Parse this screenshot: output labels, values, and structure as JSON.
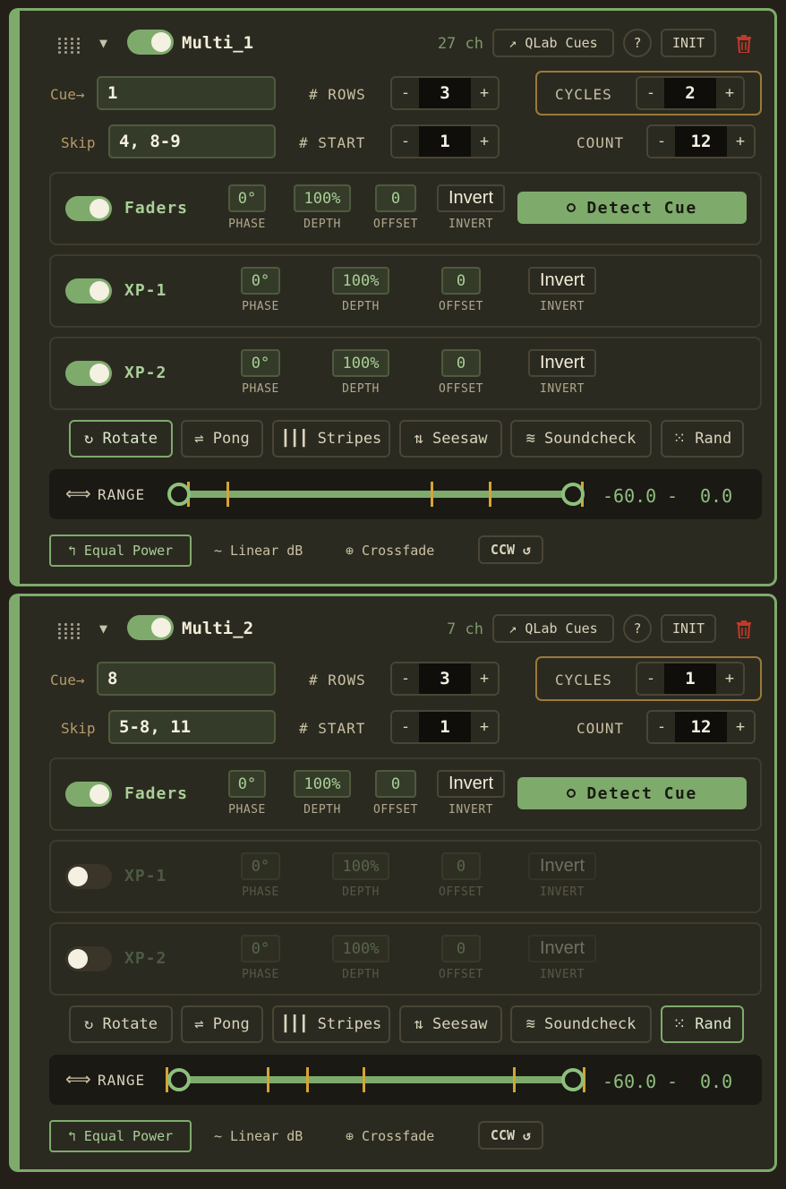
{
  "panels": [
    {
      "title": "Multi_1",
      "enabled": true,
      "channels": "27 ch",
      "qlab_label": "↗ QLab Cues",
      "help_label": "?",
      "init_label": "INIT",
      "cue_label": "Cue→",
      "cue_value": "1",
      "skip_label": "Skip",
      "skip_value": "4, 8-9",
      "rows_label": "# ROWS",
      "rows_value": "3",
      "start_label": "# START",
      "start_value": "1",
      "cycles_label": "CYCLES",
      "cycles_value": "2",
      "count_label": "COUNT",
      "count_value": "12",
      "minus": "-",
      "plus": "+",
      "detect_label": "Detect Cue",
      "tracks": [
        {
          "name": "Faders",
          "enabled": true,
          "phase": "0°",
          "depth": "100%",
          "offset": "0",
          "invert": "Invert"
        },
        {
          "name": "XP-1",
          "enabled": true,
          "phase": "0°",
          "depth": "100%",
          "offset": "0",
          "invert": "Invert"
        },
        {
          "name": "XP-2",
          "enabled": true,
          "phase": "0°",
          "depth": "100%",
          "offset": "0",
          "invert": "Invert"
        }
      ],
      "param_labels": {
        "phase": "PHASE",
        "depth": "DEPTH",
        "offset": "OFFSET",
        "invert": "INVERT"
      },
      "modes": [
        "↻ Rotate",
        "⇌ Pong",
        "┃┃┃ Stripes",
        "⇅ Seesaw",
        "≋ Soundcheck",
        "⁙ Rand"
      ],
      "selected_mode": "↻ Rotate",
      "range_label": "RANGE",
      "range_min": "-60.0",
      "range_sep": "-",
      "range_max": "0.0",
      "curves": [
        "↰ Equal Power",
        "~ Linear dB",
        "⊕ Crossfade"
      ],
      "selected_curve": "↰ Equal Power",
      "direction": "CCW ↺"
    },
    {
      "title": "Multi_2",
      "enabled": true,
      "channels": "7 ch",
      "qlab_label": "↗ QLab Cues",
      "help_label": "?",
      "init_label": "INIT",
      "cue_label": "Cue→",
      "cue_value": "8",
      "skip_label": "Skip",
      "skip_value": "5-8, 11",
      "rows_label": "# ROWS",
      "rows_value": "3",
      "start_label": "# START",
      "start_value": "1",
      "cycles_label": "CYCLES",
      "cycles_value": "1",
      "count_label": "COUNT",
      "count_value": "12",
      "minus": "-",
      "plus": "+",
      "detect_label": "Detect Cue",
      "tracks": [
        {
          "name": "Faders",
          "enabled": true,
          "phase": "0°",
          "depth": "100%",
          "offset": "0",
          "invert": "Invert"
        },
        {
          "name": "XP-1",
          "enabled": false,
          "phase": "0°",
          "depth": "100%",
          "offset": "0",
          "invert": "Invert"
        },
        {
          "name": "XP-2",
          "enabled": false,
          "phase": "0°",
          "depth": "100%",
          "offset": "0",
          "invert": "Invert"
        }
      ],
      "param_labels": {
        "phase": "PHASE",
        "depth": "DEPTH",
        "offset": "OFFSET",
        "invert": "INVERT"
      },
      "modes": [
        "↻ Rotate",
        "⇌ Pong",
        "┃┃┃ Stripes",
        "⇅ Seesaw",
        "≋ Soundcheck",
        "⁙ Rand"
      ],
      "selected_mode": "⁙ Rand",
      "range_label": "RANGE",
      "range_min": "-60.0",
      "range_sep": "-",
      "range_max": "0.0",
      "curves": [
        "↰ Equal Power",
        "~ Linear dB",
        "⊕ Crossfade"
      ],
      "selected_curve": "↰ Equal Power",
      "direction": "CCW ↺"
    }
  ],
  "colors": {
    "accent": "#7eab6c",
    "cycles_border": "#9a7a3a",
    "trash": "#c0392b",
    "tick": "#d6a434"
  }
}
